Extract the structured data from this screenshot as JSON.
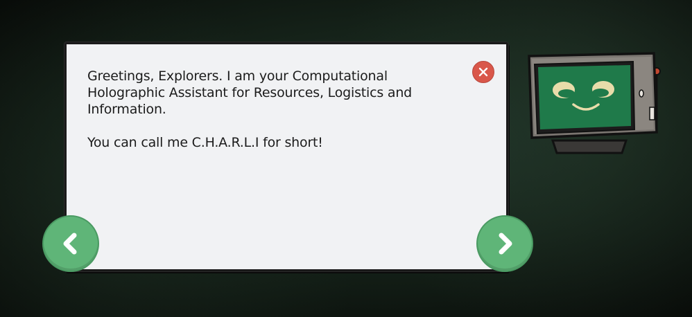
{
  "dialog": {
    "paragraph_1": "Greetings, Explorers. I am your Computational Holographic Assistant for Resources, Logistics and Information.",
    "paragraph_2": "You can call me C.H.A.R.L.I for short!"
  },
  "icons": {
    "close": "close-icon",
    "prev": "chevron-left-icon",
    "next": "chevron-right-icon",
    "assistant": "robot-monitor-icon"
  },
  "colors": {
    "panel": "#f1f2f4",
    "close_button": "#d9574a",
    "nav_button": "#5fb578",
    "screen": "#1f7a4a",
    "background": "#152219"
  }
}
